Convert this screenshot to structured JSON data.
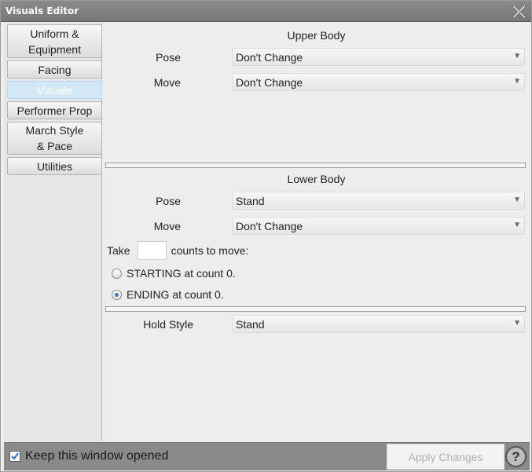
{
  "window": {
    "title": "Visuals Editor"
  },
  "sidebar": {
    "items": [
      {
        "label": "Uniform &\nEquipment"
      },
      {
        "label": "Facing"
      },
      {
        "label": "Visuals"
      },
      {
        "label": "Performer Prop"
      },
      {
        "label": "March Style\n& Pace"
      },
      {
        "label": "Utilities"
      }
    ],
    "active": "Visuals"
  },
  "upper_body": {
    "title": "Upper Body",
    "pose_label": "Pose",
    "pose_value": "Don't Change",
    "move_label": "Move",
    "move_value": "Don't Change"
  },
  "lower_body": {
    "title": "Lower Body",
    "pose_label": "Pose",
    "pose_value": "Stand",
    "move_label": "Move",
    "move_value": "Don't Change",
    "take_label": "Take",
    "count_value": "",
    "counts_label": "counts to move:",
    "starting_label": "STARTING at count 0.",
    "ending_label": "ENDING at count 0.",
    "selected_timing": "ending"
  },
  "hold": {
    "label": "Hold Style",
    "value": "Stand"
  },
  "footer": {
    "keep_open_label": "Keep this window opened",
    "keep_open_checked": true,
    "apply_label": "Apply Changes",
    "help_label": "?"
  }
}
